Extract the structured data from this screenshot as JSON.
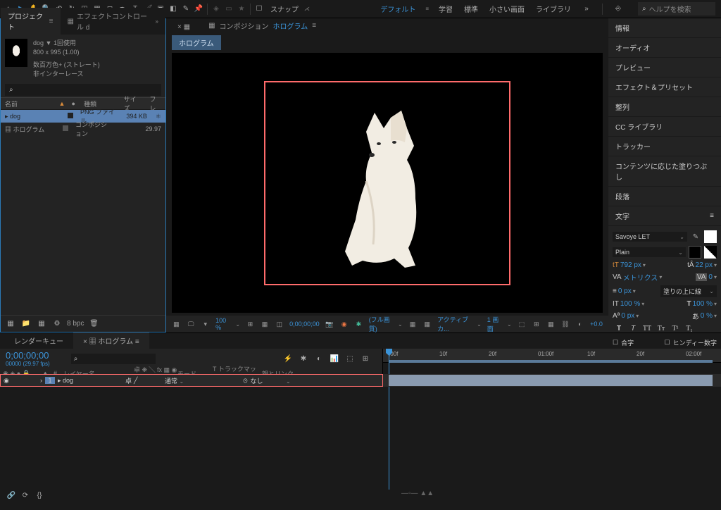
{
  "toolbar": {
    "snap_label": "スナップ",
    "workspaces": [
      "デフォルト",
      "学習",
      "標準",
      "小さい画面",
      "ライブラリ"
    ],
    "search_placeholder": "ヘルプを検索"
  },
  "project_panel": {
    "tab_project": "プロジェクト",
    "tab_effect_controls": "エフェクトコントロール d",
    "asset_name": "dog",
    "asset_usage": "1回使用",
    "asset_dims": "800 x 995 (1.00)",
    "asset_color": "数百万色+ (ストレート)",
    "asset_interlace": "非インターレース",
    "cols": {
      "name": "名前",
      "tag": "●",
      "type": "種類",
      "size": "サイズ",
      "fr": "フレ..."
    },
    "rows": [
      {
        "name": "dog",
        "type": "PNG ファイル",
        "size": "394 KB",
        "fr": ""
      },
      {
        "name": "ホログラム",
        "type": "コンポジション",
        "size": "",
        "fr": "29.97"
      }
    ],
    "footer_bpc": "8 bpc"
  },
  "comp_panel": {
    "tab_prefix": "コンポジション",
    "tab_name": "ホログラム",
    "subtab": "ホログラム",
    "footer": {
      "zoom": "100 %",
      "time": "0;00;00;00",
      "quality": "(フル画質)",
      "camera": "アクティブカ...",
      "view": "1 画面",
      "exposure": "+0.0"
    }
  },
  "right_panels": {
    "items": [
      "情報",
      "オーディオ",
      "プレビュー",
      "エフェクト＆プリセット",
      "整列",
      "CC ライブラリ",
      "トラッカー",
      "コンテンツに応じた塗りつぶし",
      "段落"
    ],
    "char_header": "文字",
    "font": "Savoye LET",
    "font_style": "Plain",
    "size": "792 px",
    "leading": "22 px",
    "kerning": "メトリクス",
    "tracking": "0",
    "stroke": "0 px",
    "stroke_mode": "塗りの上に線",
    "vscale": "100 %",
    "hscale": "100 %",
    "baseline": "0 px",
    "tsume": "0 %",
    "ligatures": "合字",
    "hindi": "ヒンディー数字"
  },
  "timeline": {
    "tab_render": "レンダーキュー",
    "tab_comp": "ホログラム",
    "timecode": "0;00;00;00",
    "fps_label": "00000 (29.97 fps)",
    "cols": {
      "layer_name": "レイヤー名",
      "mode": "モード",
      "trkmat": "T トラックマット",
      "parent": "親とリンク"
    },
    "layer": {
      "num": "1",
      "name": "dog",
      "mode": "通常",
      "parent": "なし"
    },
    "ruler": [
      {
        "pos": 8,
        "label": ";00f"
      },
      {
        "pos": 80,
        "label": "10f"
      },
      {
        "pos": 150,
        "label": "20f"
      },
      {
        "pos": 220,
        "label": "01:00f"
      },
      {
        "pos": 290,
        "label": "10f"
      },
      {
        "pos": 360,
        "label": "20f"
      },
      {
        "pos": 430,
        "label": "02:00f"
      }
    ]
  }
}
